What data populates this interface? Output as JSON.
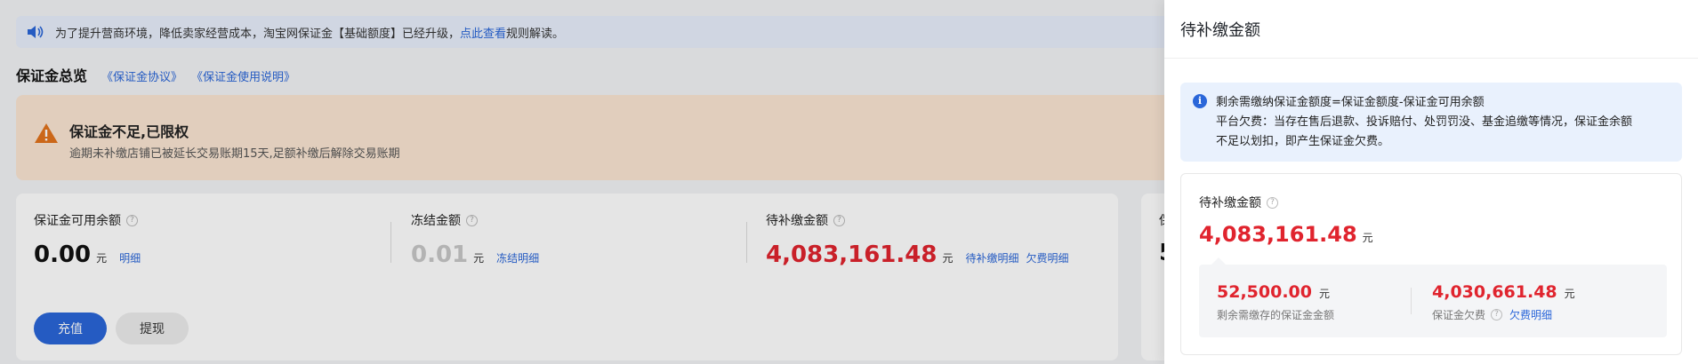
{
  "notice": {
    "text": "为了提升营商环境，降低卖家经营成本，淘宝网保证金【基础额度】已经升级，",
    "link": "点此查看",
    "suffix": "规则解读。"
  },
  "overview": {
    "title": "保证金总览",
    "links": [
      "《保证金协议》",
      "《保证金使用说明》"
    ]
  },
  "warning": {
    "title": "保证金不足,已限权",
    "desc": "逾期未补缴店铺已被延长交易账期15天,足额补缴后解除交易账期"
  },
  "metrics": [
    {
      "label": "保证金可用余额",
      "value": "0.00",
      "unit": "元",
      "links": [
        "明细"
      ],
      "color": "#111111"
    },
    {
      "label": "冻结金额",
      "value": "0.01",
      "unit": "元",
      "links": [
        "冻结明细"
      ],
      "color": "#c8c8c8"
    },
    {
      "label": "待补缴金额",
      "value": "4,083,161.48",
      "unit": "元",
      "links": [
        "待补缴明细",
        "欠费明细"
      ],
      "color": "#e0242e"
    }
  ],
  "card2": {
    "label": "保",
    "value": "5"
  },
  "buttons": {
    "recharge": "充值",
    "withdraw": "提现"
  },
  "drawer": {
    "title": "待补缴金额",
    "info_lines": [
      "剩余需缴纳保证金额度=保证金额度-保证金可用余额",
      "平台欠费：当存在售后退款、投诉赔付、处罚罚没、基金追缴等情况，保证金余额",
      "不足以划扣，即产生保证金欠费。"
    ],
    "box_label": "待补缴金额",
    "box_value": "4,083,161.48",
    "box_unit": "元",
    "sub": [
      {
        "value": "52,500.00",
        "unit": "元",
        "caption": "剩余需缴存的保证金金额"
      },
      {
        "value": "4,030,661.48",
        "unit": "元",
        "caption": "保证金欠费",
        "link": "欠费明细"
      }
    ]
  },
  "colors": {
    "accent": "#2a66d9",
    "danger": "#e0242e",
    "warning_bg": "#fbe6d3",
    "info_bg": "#e9f1fd"
  }
}
